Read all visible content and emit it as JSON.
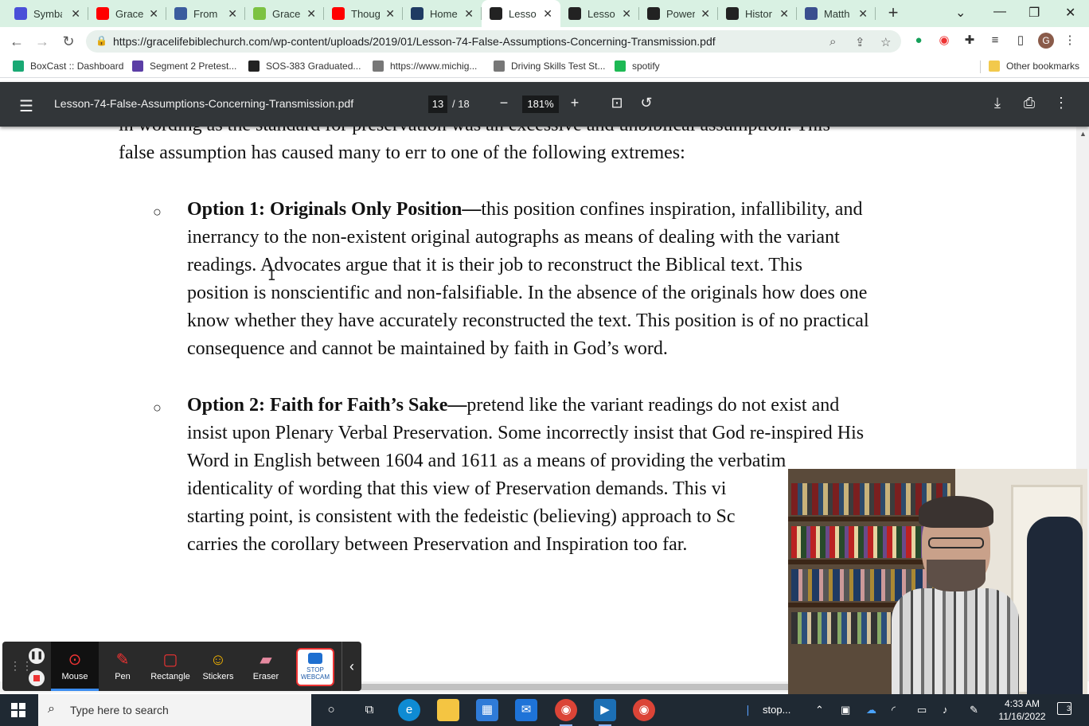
{
  "browser": {
    "tabs": [
      {
        "title": "Symba",
        "favicon": "zoom-icon",
        "color": "#4a4fd8"
      },
      {
        "title": "Grace",
        "favicon": "youtube-icon",
        "color": "#ff0000"
      },
      {
        "title": "From",
        "favicon": "globe-icon",
        "color": "#3b5c9e"
      },
      {
        "title": "Grace",
        "favicon": "play-icon",
        "color": "#7cc242"
      },
      {
        "title": "Thoug",
        "favicon": "youtube-icon",
        "color": "#ff0000"
      },
      {
        "title": "Home",
        "favicon": "people-icon",
        "color": "#1f3b63"
      },
      {
        "title": "Lesso",
        "favicon": "document-icon",
        "color": "#222222",
        "active": true
      },
      {
        "title": "Lesso",
        "favicon": "document-icon",
        "color": "#222222"
      },
      {
        "title": "Power",
        "favicon": "document-icon",
        "color": "#222222"
      },
      {
        "title": "Histor",
        "favicon": "document-icon",
        "color": "#222222"
      },
      {
        "title": "Matth",
        "favicon": "bible-icon",
        "color": "#3b4f8f"
      }
    ],
    "url": "https://gracelifebiblechurch.com/wp-content/uploads/2019/01/Lesson-74-False-Assumptions-Concerning-Transmission.pdf",
    "profile_initial": "G",
    "bookmarks": [
      {
        "label": "BoxCast :: Dashboard",
        "color": "#19a974"
      },
      {
        "label": "Segment 2 Pretest...",
        "color": "#5b3ea6"
      },
      {
        "label": "SOS-383 Graduated...",
        "color": "#222222"
      },
      {
        "label": "https://www.michig...",
        "color": "#777777"
      },
      {
        "label": "Driving Skills Test St...",
        "color": "#777777"
      },
      {
        "label": "spotify",
        "color": "#1db954"
      }
    ],
    "other_bookmarks": "Other bookmarks"
  },
  "pdf_viewer": {
    "filename": "Lesson-74-False-Assumptions-Concerning-Transmission.pdf",
    "current_page": "13",
    "page_total": "/  18",
    "zoom": "181%"
  },
  "document": {
    "intro_lines": [
      "in wording as the standard for preservation was an excessive and unbiblical assumption.  This",
      "false assumption has caused many to err to one of the following extremes:"
    ],
    "bullet_symbol": "○",
    "options": [
      {
        "heading": "Option 1: Originals Only Position—",
        "lines": [
          "this position confines inspiration, infallibility, and",
          "inerrancy to the non-existent original autographs as means of dealing with the variant",
          "readings.  Advocates argue that it is their job to reconstruct the Biblical text.  This",
          "position is nonscientific and non-falsifiable. In the absence of the originals how does one",
          "know whether they have accurately reconstructed the text.  This position is of no practical",
          "consequence and cannot be maintained by faith in God’s word."
        ]
      },
      {
        "heading": "Option 2: Faith for Faith’s Sake—",
        "lines": [
          "pretend like the variant readings do not exist and",
          "insist upon Plenary Verbal Preservation.  Some incorrectly insist that God re-inspired His",
          "Word in English between 1604 and 1611 as a means of providing the verbatim",
          "identicality of wording that this view of Preservation demands.  This vi",
          "starting point, is consistent with the fedeistic (believing) approach to Sc",
          "carries the corollary between Preservation and Inspiration too far."
        ]
      }
    ]
  },
  "annotation_toolbar": {
    "tools": [
      {
        "label": "Mouse",
        "icon": "mouse-cursor-icon",
        "active": true
      },
      {
        "label": "Pen",
        "icon": "pen-icon"
      },
      {
        "label": "Rectangle",
        "icon": "rectangle-icon"
      },
      {
        "label": "Stickers",
        "icon": "smiley-icon"
      },
      {
        "label": "Eraser",
        "icon": "eraser-icon"
      }
    ],
    "stop_webcam_label": "STOP WEBCAM"
  },
  "taskbar": {
    "search_placeholder": "Type here to search",
    "tray_item": "stop...",
    "time": "4:33 AM",
    "date": "11/16/2022",
    "notification_count": "3"
  },
  "colors": {
    "tab_strip": "#d9f1e3",
    "pdf_toolbar": "#323639",
    "taskbar": "#1f2933",
    "annotation_red": "#e33333"
  }
}
